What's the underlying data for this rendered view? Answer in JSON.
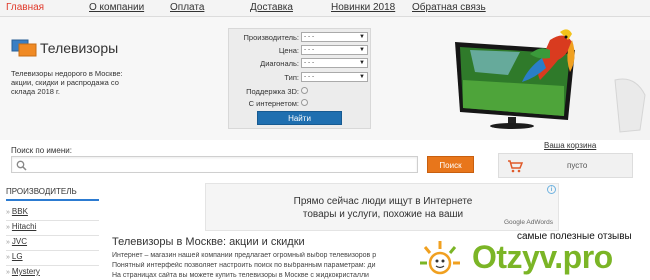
{
  "nav": {
    "items": [
      {
        "label": "Главная"
      },
      {
        "label": "О компании"
      },
      {
        "label": "Оплата"
      },
      {
        "label": "Доставка"
      },
      {
        "label": "Новинки 2018"
      },
      {
        "label": "Обратная связь"
      }
    ]
  },
  "header": {
    "title": "Телевизоры",
    "description": "Телевизоры недорого в Москве: акции, скидки и распродажа со склада 2018 г."
  },
  "filter": {
    "manufacturer": {
      "label": "Производитель:",
      "value": "- - -"
    },
    "price": {
      "label": "Цена:",
      "value": "- - -"
    },
    "diagonal": {
      "label": "Диагональ:",
      "value": "- - -"
    },
    "type": {
      "label": "Тип:",
      "value": "- - -"
    },
    "support3d": {
      "label": "Поддержка 3D:"
    },
    "internet": {
      "label": "С интернетом:"
    },
    "submit_label": "Найти"
  },
  "search": {
    "label": "Поиск по имени:",
    "value": "",
    "button_label": "Поиск"
  },
  "cart": {
    "title": "Ваша корзина",
    "status": "пусто"
  },
  "sidebar": {
    "heading": "ПРОИЗВОДИТЕЛЬ",
    "brands": [
      "BBK",
      "Hitachi",
      "JVC",
      "LG",
      "Mystery"
    ]
  },
  "ad": {
    "line1": "Прямо сейчас люди ищут в Интернете",
    "line2": "товары и услуги, похожие на ваши",
    "brand": "Google AdWords",
    "info": "i"
  },
  "main": {
    "title": "Телевизоры в Москве: акции и скидки",
    "lines": [
      "Интернет – магазин нашей компании предлагает огромный выбор телевизоров р",
      "Понятный интерфейс позволяет настроить поиск по выбранным параметрам: ди",
      "На страницах сайта вы можете купить телевизоры в Москве с жидкокристалли"
    ]
  },
  "watermark": {
    "top": "самые полезные отзывы",
    "logo": "Otzyv.pro"
  },
  "colors": {
    "nav_active": "#e0392a",
    "find_button": "#1f6fb0",
    "search_button": "#e8761b",
    "sidebar_rule": "#2c7bd1",
    "watermark_logo": "#7bb526"
  }
}
